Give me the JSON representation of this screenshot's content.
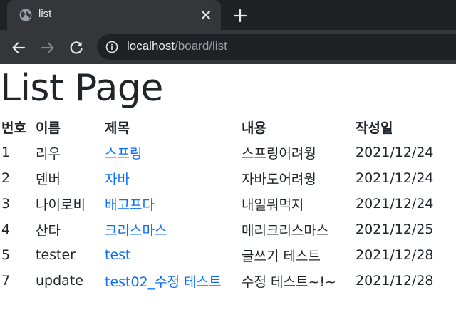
{
  "browser": {
    "tab": {
      "title": "list"
    },
    "url": {
      "host": "localhost",
      "path": "/board/list"
    }
  },
  "page": {
    "title": "List Page",
    "table": {
      "headers": {
        "bno": "번호",
        "writer": "이름",
        "title": "제목",
        "content": "내용",
        "regdate": "작성일"
      },
      "rows": [
        {
          "bno": "1",
          "writer": "리우",
          "title": "스프링",
          "content": "스프링어려웡",
          "regdate": "2021/12/24"
        },
        {
          "bno": "2",
          "writer": "덴버",
          "title": "자바",
          "content": "자바도어려웡",
          "regdate": "2021/12/24"
        },
        {
          "bno": "3",
          "writer": "나이로비",
          "title": "배고프다",
          "content": "내일뭐먹지",
          "regdate": "2021/12/24"
        },
        {
          "bno": "4",
          "writer": "산타",
          "title": "크리스마스",
          "content": "메리크리스마스",
          "regdate": "2021/12/25"
        },
        {
          "bno": "5",
          "writer": "tester",
          "title": "test",
          "content": "글쓰기 테스트",
          "regdate": "2021/12/28"
        },
        {
          "bno": "7",
          "writer": "update",
          "title": "test02_수정 테스트",
          "content": "수정 테스트~!~",
          "regdate": "2021/12/28"
        }
      ]
    }
  },
  "icons": {
    "tab_favicon": "globe-icon",
    "tab_close": "close-icon",
    "new_tab": "plus-icon",
    "back": "arrow-left-icon",
    "forward": "arrow-right-icon",
    "reload": "reload-icon",
    "site_info": "info-icon"
  },
  "colors": {
    "link": "#0d6efd",
    "text": "#212529",
    "chrome_dark": "#202124",
    "chrome_mid": "#35363a"
  }
}
